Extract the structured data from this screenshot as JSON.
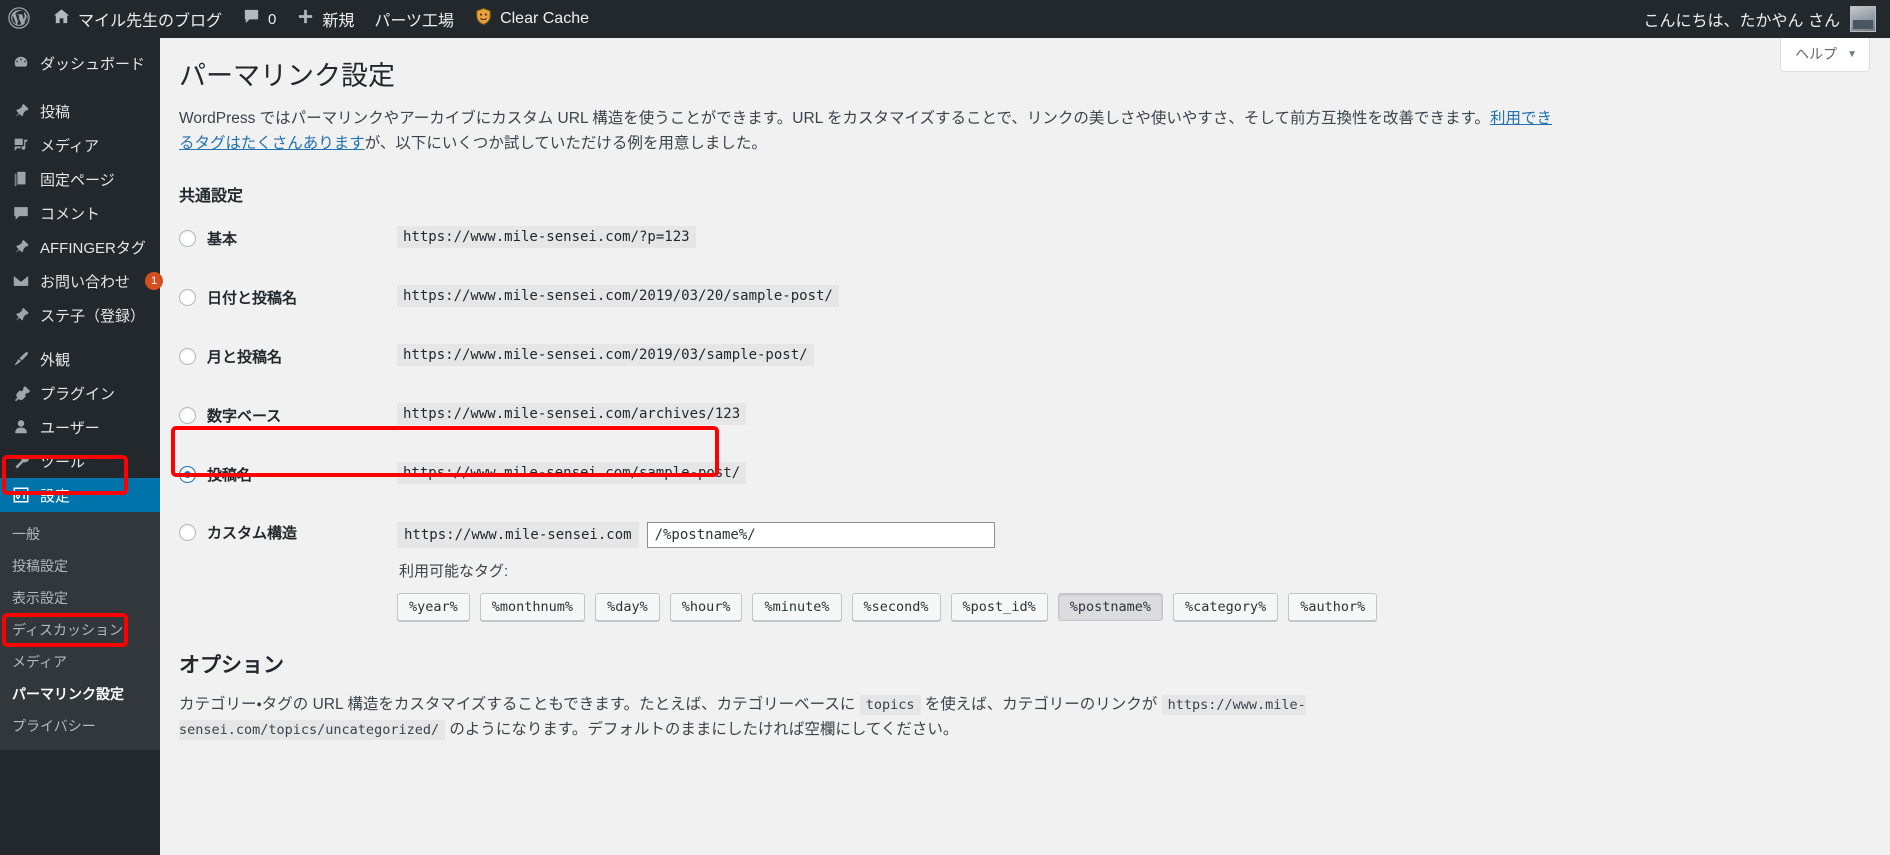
{
  "adminbar": {
    "logo_icon": "wordpress-logo-icon",
    "site_name": "マイル先生のブログ",
    "home_icon": "home-icon",
    "comment_icon": "comment-bubble-icon",
    "comment_count": "0",
    "new_icon": "plus-icon",
    "new_label": "新規",
    "parts_label": "パーツ工場",
    "clear_cache_icon": "cache-shield-icon",
    "clear_cache_label": "Clear Cache",
    "greeting": "こんにちは、たかやん さん",
    "avatar_name": "avatar"
  },
  "sidebar": {
    "items": [
      {
        "label": "ダッシュボード",
        "icon": "dashboard-icon",
        "current": false
      },
      {
        "label": "投稿",
        "icon": "pin-icon",
        "current": false
      },
      {
        "label": "メディア",
        "icon": "media-icon",
        "current": false
      },
      {
        "label": "固定ページ",
        "icon": "pages-icon",
        "current": false
      },
      {
        "label": "コメント",
        "icon": "comment-bubble-icon",
        "current": false
      },
      {
        "label": "AFFINGERタグ",
        "icon": "pin-icon",
        "current": false
      },
      {
        "label": "お問い合わせ",
        "icon": "mail-icon",
        "current": false,
        "badge": "1"
      },
      {
        "label": "ステ子（登録）",
        "icon": "pin-icon",
        "current": false
      },
      {
        "label": "外観",
        "icon": "appearance-brush-icon",
        "current": false
      },
      {
        "label": "プラグイン",
        "icon": "plugin-icon",
        "current": false
      },
      {
        "label": "ユーザー",
        "icon": "user-icon",
        "current": false
      },
      {
        "label": "ツール",
        "icon": "wrench-icon",
        "current": false
      },
      {
        "label": "設定",
        "icon": "settings-sliders-icon",
        "current": true
      }
    ],
    "submenu": [
      {
        "label": "一般",
        "current": false
      },
      {
        "label": "投稿設定",
        "current": false
      },
      {
        "label": "表示設定",
        "current": false
      },
      {
        "label": "ディスカッション",
        "current": false
      },
      {
        "label": "メディア",
        "current": false
      },
      {
        "label": "パーマリンク設定",
        "current": true
      },
      {
        "label": "プライバシー",
        "current": false
      }
    ]
  },
  "help": {
    "label": "ヘルプ",
    "caret": "▼"
  },
  "page": {
    "title": "パーマリンク設定",
    "intro_part1": "WordPress ではパーマリンクやアーカイブにカスタム URL 構造を使うことができます。URL をカスタマイズすることで、リンクの美しさや使いやすさ、そして前方互換性を改善できます。",
    "intro_link": "利用できるタグはたくさんあります",
    "intro_part2": "が、以下にいくつか試していただける例を用意しました。",
    "common_settings_heading": "共通設定"
  },
  "permalink_options": [
    {
      "label": "基本",
      "url": "https://www.mile-sensei.com/?p=123",
      "selected": false
    },
    {
      "label": "日付と投稿名",
      "url": "https://www.mile-sensei.com/2019/03/20/sample-post/",
      "selected": false
    },
    {
      "label": "月と投稿名",
      "url": "https://www.mile-sensei.com/2019/03/sample-post/",
      "selected": false
    },
    {
      "label": "数字ベース",
      "url": "https://www.mile-sensei.com/archives/123",
      "selected": false
    },
    {
      "label": "投稿名",
      "url": "https://www.mile-sensei.com/sample-post/",
      "selected": true,
      "highlighted": true
    }
  ],
  "custom_structure": {
    "label": "カスタム構造",
    "selected": false,
    "base_url": "https://www.mile-sensei.com",
    "value": "/%postname%/",
    "available_tags_label": "利用可能なタグ:",
    "tags": [
      {
        "label": "%year%",
        "active": false
      },
      {
        "label": "%monthnum%",
        "active": false
      },
      {
        "label": "%day%",
        "active": false
      },
      {
        "label": "%hour%",
        "active": false
      },
      {
        "label": "%minute%",
        "active": false
      },
      {
        "label": "%second%",
        "active": false
      },
      {
        "label": "%post_id%",
        "active": false
      },
      {
        "label": "%postname%",
        "active": true
      },
      {
        "label": "%category%",
        "active": false
      },
      {
        "label": "%author%",
        "active": false
      }
    ]
  },
  "options_section": {
    "title": "オプション",
    "desc_part1": "カテゴリー・タグの URL 構造をカスタマイズすることもできます。たとえば、カテゴリーベースに ",
    "desc_code1": "topics",
    "desc_part2": " を使えば、カテゴリーのリンクが ",
    "desc_code2": "https://www.mile-sensei.com/topics/uncategorized/",
    "desc_part3": " のようになります。デフォルトのままにしたければ空欄にしてください。"
  },
  "colors": {
    "admin_bar_bg": "#23282d",
    "sidebar_bg": "#23282d",
    "submenu_bg": "#32373c",
    "current_menu": "#0073aa",
    "page_bg": "#f1f1f1",
    "annotation_red": "#ff0000",
    "badge_orange": "#d54e21",
    "link_blue": "#2271b1"
  }
}
